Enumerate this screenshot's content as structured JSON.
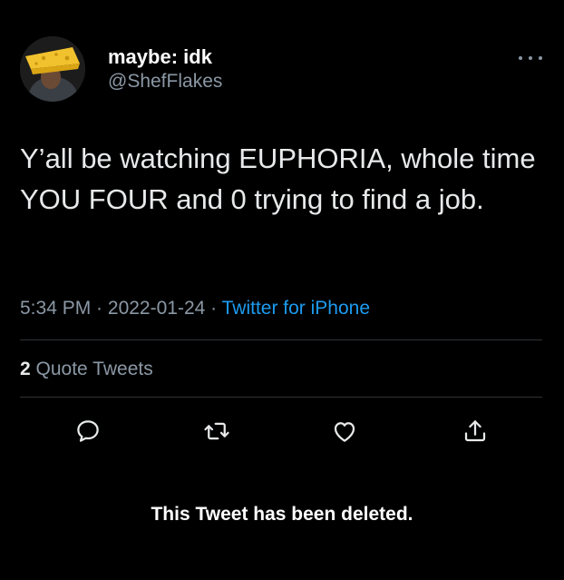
{
  "tweet": {
    "display_name": "maybe: idk",
    "handle": "@ShefFlakes",
    "text": "Y’all be watching EUPHORIA, whole time YOU FOUR and 0 trying to find a job.",
    "time": "5:34 PM",
    "date": "2022-01-24",
    "separator": " · ",
    "source": "Twitter for iPhone",
    "quote_count": "2",
    "quote_label": " Quote Tweets"
  },
  "actions": {
    "reply_icon": "reply-icon",
    "retweet_icon": "retweet-icon",
    "like_icon": "heart-icon",
    "share_icon": "share-icon"
  },
  "notice": {
    "deleted_text": "This Tweet has been deleted."
  },
  "colors": {
    "background": "#000000",
    "text": "#e7e9ea",
    "muted": "#8b98a5",
    "link": "#1d9bf0"
  }
}
